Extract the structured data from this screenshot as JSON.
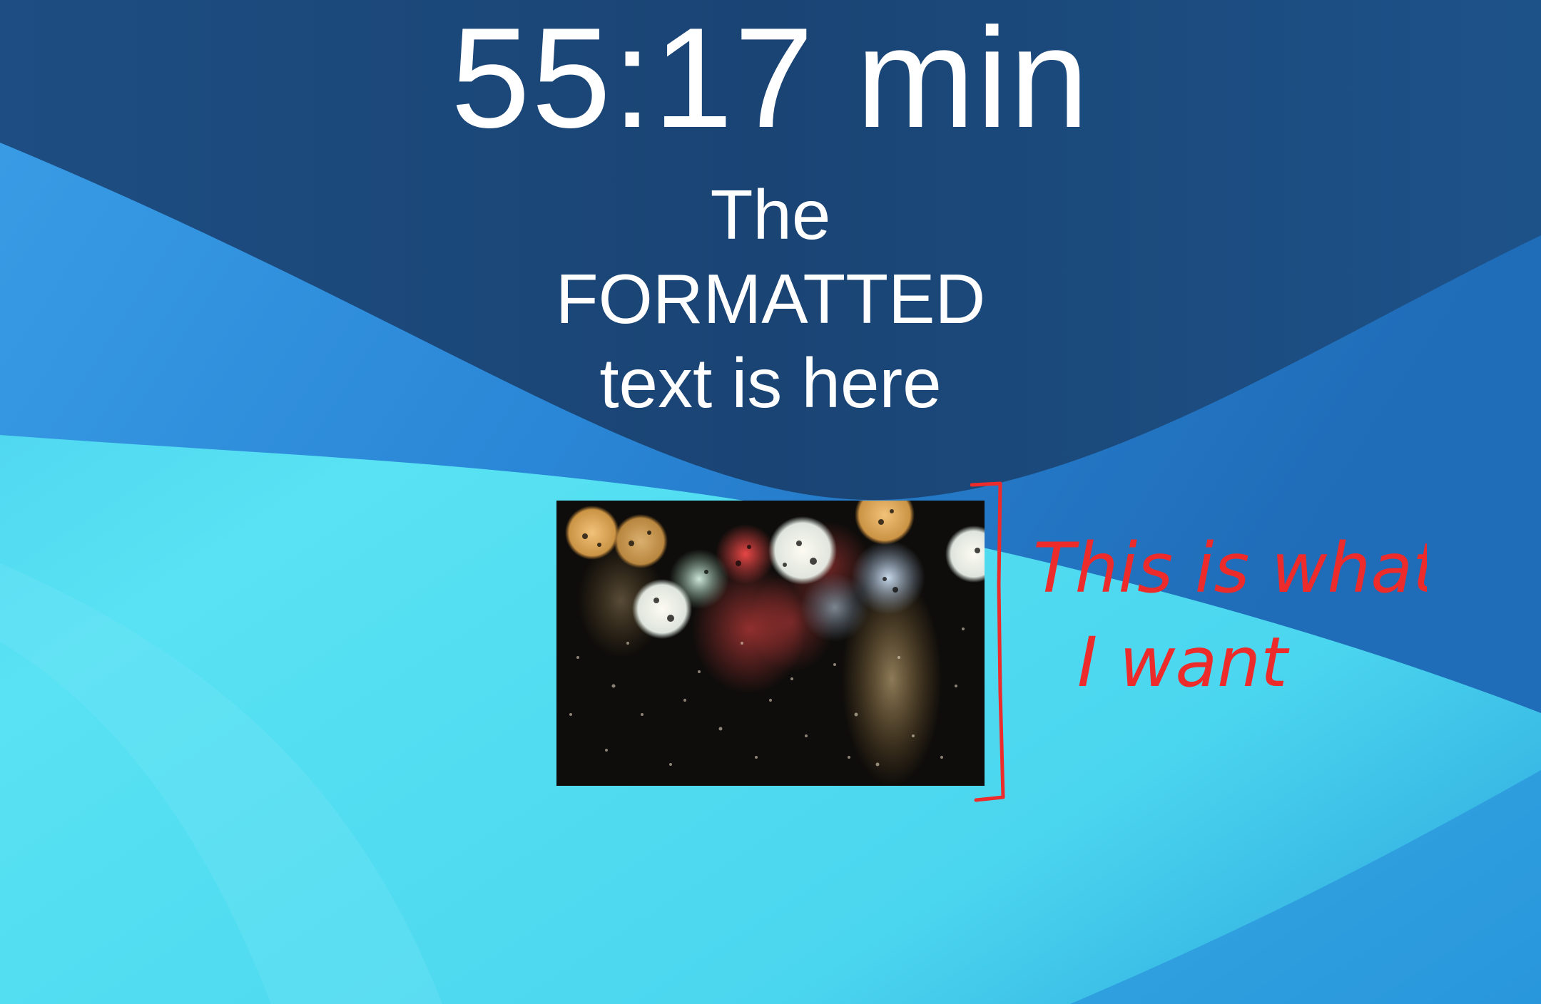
{
  "wallpaper": {
    "colors": {
      "dark_blue": "#1b4878",
      "mid_blue": "#2b86d4",
      "light_cyan": "#55dcf0"
    }
  },
  "overlay": {
    "timer": "55:17 min",
    "formatted_text_lines": [
      "The",
      "FORMATTED",
      "text is here"
    ],
    "text_color": "#ffffff"
  },
  "image": {
    "icon": "rainy-window-bokeh-photo"
  },
  "annotation": {
    "text_line1": "This is what",
    "text_line2": "I want",
    "color": "#ee2b2b"
  }
}
